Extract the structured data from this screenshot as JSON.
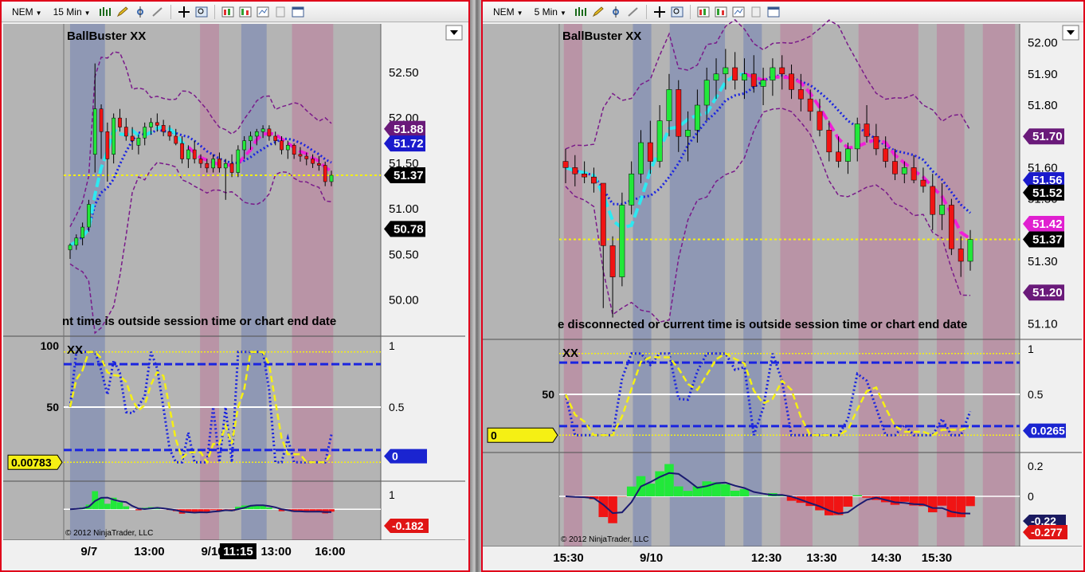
{
  "colors": {
    "panel_bg": "#b4b4b4",
    "blue_shade": "#8f98b4",
    "pink_shade": "#b994a6",
    "up_bar": "#22e83a",
    "down_bar": "#f01414",
    "cyan_line": "#2ee8f0",
    "magenta_line": "#f020d8",
    "blue_line": "#1a24e0",
    "purple_band": "#7a1a8a",
    "yellow_line": "#f5f014"
  },
  "toolbar": {
    "left": {
      "instrument": "NEM",
      "period": "15 Min"
    },
    "right": {
      "instrument": "NEM",
      "period": "5 Min"
    }
  },
  "chart_data": [
    {
      "type": "candlestick",
      "title": "BallBuster XX",
      "interval": "15 Min",
      "message": "nt time is outside session time or chart end date",
      "price_axis": {
        "ticks": [
          "52.50",
          "52.00",
          "51.50",
          "51.00",
          "50.50",
          "50.00"
        ],
        "ylim": [
          49.6,
          53.0
        ]
      },
      "price_labels": [
        {
          "value": "51.88",
          "color": "#6a1a7a"
        },
        {
          "value": "51.72",
          "color": "#1a1acc"
        },
        {
          "value": "51.37",
          "color": "#000000"
        },
        {
          "value": "50.78",
          "color": "#000000"
        }
      ],
      "oscillator": {
        "label": "XX",
        "left_ticks": [
          "100",
          "50"
        ],
        "right_ticks": [
          "1",
          "0.5"
        ],
        "current_value": "0.00783",
        "right_value": "0"
      },
      "histogram": {
        "right_ticks": [
          "1"
        ],
        "current_value": "-0.182"
      },
      "x_ticks": [
        "9/7",
        "13:00",
        "9/10",
        "11:15",
        "13:00",
        "16:00"
      ],
      "copyright": "© 2012 NinjaTrader, LLC",
      "candles": [
        [
          50.55,
          50.62,
          50.45,
          50.6
        ],
        [
          50.6,
          50.72,
          50.55,
          50.68
        ],
        [
          50.68,
          50.85,
          50.6,
          50.8
        ],
        [
          50.8,
          51.1,
          50.75,
          51.05
        ],
        [
          51.6,
          52.6,
          51.4,
          52.1
        ],
        [
          52.1,
          52.15,
          51.55,
          51.85
        ],
        [
          51.85,
          51.95,
          51.3,
          51.55
        ],
        [
          51.6,
          52.05,
          51.5,
          52.0
        ],
        [
          52.0,
          52.1,
          51.85,
          51.9
        ],
        [
          51.9,
          52.0,
          51.75,
          51.8
        ],
        [
          51.8,
          51.9,
          51.65,
          51.75
        ],
        [
          51.7,
          51.82,
          51.6,
          51.78
        ],
        [
          51.78,
          51.95,
          51.7,
          51.9
        ],
        [
          51.9,
          52.0,
          51.82,
          51.95
        ],
        [
          51.95,
          52.05,
          51.85,
          51.92
        ],
        [
          51.92,
          51.98,
          51.8,
          51.85
        ],
        [
          51.85,
          51.92,
          51.75,
          51.8
        ],
        [
          51.8,
          51.88,
          51.7,
          51.72
        ],
        [
          51.72,
          51.8,
          51.5,
          51.55
        ],
        [
          51.55,
          51.7,
          51.45,
          51.65
        ],
        [
          51.65,
          51.75,
          51.5,
          51.55
        ],
        [
          51.55,
          51.6,
          51.45,
          51.5
        ],
        [
          51.5,
          51.55,
          51.4,
          51.45
        ],
        [
          51.45,
          51.6,
          51.4,
          51.55
        ],
        [
          51.55,
          51.62,
          51.4,
          51.45
        ],
        [
          51.45,
          51.55,
          51.1,
          51.5
        ],
        [
          51.5,
          51.6,
          51.35,
          51.4
        ],
        [
          51.4,
          51.7,
          51.35,
          51.65
        ],
        [
          51.65,
          51.8,
          51.55,
          51.75
        ],
        [
          51.75,
          51.85,
          51.65,
          51.8
        ],
        [
          51.8,
          51.88,
          51.7,
          51.85
        ],
        [
          51.85,
          51.92,
          51.78,
          51.88
        ],
        [
          51.88,
          51.92,
          51.75,
          51.8
        ],
        [
          51.8,
          51.85,
          51.7,
          51.75
        ],
        [
          51.75,
          51.8,
          51.6,
          51.65
        ],
        [
          51.65,
          51.75,
          51.55,
          51.7
        ],
        [
          51.7,
          51.72,
          51.55,
          51.6
        ],
        [
          51.6,
          51.68,
          51.52,
          51.58
        ],
        [
          51.58,
          51.62,
          51.48,
          51.55
        ],
        [
          51.55,
          51.6,
          51.45,
          51.5
        ],
        [
          51.5,
          51.58,
          51.42,
          51.48
        ],
        [
          51.48,
          51.52,
          51.25,
          51.3
        ],
        [
          51.3,
          51.42,
          51.25,
          51.37
        ]
      ]
    },
    {
      "type": "candlestick",
      "title": "BallBuster XX",
      "interval": "5 Min",
      "message": "e disconnected or current time is outside session time or chart end date",
      "price_axis": {
        "ticks": [
          "52.00",
          "51.90",
          "51.80",
          "51.70",
          "51.60",
          "51.50",
          "51.40",
          "51.30",
          "51.20",
          "51.10"
        ],
        "ylim": [
          51.05,
          52.05
        ]
      },
      "price_labels": [
        {
          "value": "51.70",
          "color": "#6a1a7a"
        },
        {
          "value": "51.56",
          "color": "#1a1acc"
        },
        {
          "value": "51.52",
          "color": "#000000"
        },
        {
          "value": "51.42",
          "color": "#e020d0"
        },
        {
          "value": "51.37",
          "color": "#000000"
        },
        {
          "value": "51.20",
          "color": "#6a1a7a"
        }
      ],
      "oscillator": {
        "label": "XX",
        "left_ticks": [
          "50"
        ],
        "right_ticks": [
          "1",
          "0.5"
        ],
        "current_value": "0",
        "right_value": "0.0265"
      },
      "histogram": {
        "right_ticks": [
          "0.2",
          "0"
        ],
        "current_value": "-0.277",
        "second_value": "-0.22"
      },
      "x_ticks": [
        "15:30",
        "9/10",
        "12:30",
        "13:30",
        "14:30",
        "15:30"
      ],
      "copyright": "© 2012 NinjaTrader, LLC",
      "candles": [
        [
          51.62,
          51.66,
          51.55,
          51.6
        ],
        [
          51.6,
          51.64,
          51.54,
          51.58
        ],
        [
          51.58,
          51.62,
          51.55,
          51.57
        ],
        [
          51.57,
          51.6,
          51.52,
          51.55
        ],
        [
          51.55,
          51.52,
          51.15,
          51.35
        ],
        [
          51.35,
          51.38,
          51.12,
          51.25
        ],
        [
          51.25,
          51.52,
          51.22,
          51.48
        ],
        [
          51.48,
          51.62,
          51.45,
          51.58
        ],
        [
          51.58,
          51.72,
          51.55,
          51.68
        ],
        [
          51.68,
          51.75,
          51.58,
          51.62
        ],
        [
          51.62,
          51.8,
          51.6,
          51.75
        ],
        [
          51.75,
          51.9,
          51.7,
          51.85
        ],
        [
          51.85,
          51.88,
          51.65,
          51.7
        ],
        [
          51.7,
          51.78,
          51.62,
          51.72
        ],
        [
          51.72,
          51.85,
          51.68,
          51.8
        ],
        [
          51.8,
          51.92,
          51.75,
          51.88
        ],
        [
          51.88,
          51.95,
          51.82,
          51.9
        ],
        [
          51.9,
          51.98,
          51.85,
          51.92
        ],
        [
          51.92,
          51.97,
          51.85,
          51.88
        ],
        [
          51.88,
          51.95,
          51.82,
          51.9
        ],
        [
          51.9,
          51.96,
          51.84,
          51.86
        ],
        [
          51.86,
          51.92,
          51.8,
          51.88
        ],
        [
          51.88,
          51.95,
          51.83,
          51.92
        ],
        [
          51.92,
          51.96,
          51.85,
          51.9
        ],
        [
          51.9,
          51.93,
          51.82,
          51.85
        ],
        [
          51.85,
          51.9,
          51.78,
          51.82
        ],
        [
          51.82,
          51.85,
          51.75,
          51.78
        ],
        [
          51.78,
          51.82,
          51.7,
          51.72
        ],
        [
          51.72,
          51.75,
          51.62,
          51.65
        ],
        [
          51.65,
          51.7,
          51.6,
          51.62
        ],
        [
          51.62,
          51.68,
          51.58,
          51.66
        ],
        [
          51.66,
          51.76,
          51.62,
          51.74
        ],
        [
          51.74,
          51.8,
          51.68,
          51.7
        ],
        [
          51.7,
          51.74,
          51.64,
          51.66
        ],
        [
          51.66,
          51.7,
          51.6,
          51.62
        ],
        [
          51.62,
          51.66,
          51.56,
          51.58
        ],
        [
          51.58,
          51.62,
          51.55,
          51.6
        ],
        [
          51.6,
          51.64,
          51.55,
          51.56
        ],
        [
          51.56,
          51.6,
          51.52,
          51.54
        ],
        [
          51.54,
          51.58,
          51.4,
          51.45
        ],
        [
          51.45,
          51.55,
          51.4,
          51.48
        ],
        [
          51.48,
          51.5,
          51.32,
          51.34
        ],
        [
          51.34,
          51.38,
          51.25,
          51.3
        ],
        [
          51.3,
          51.4,
          51.27,
          51.37
        ]
      ]
    }
  ]
}
